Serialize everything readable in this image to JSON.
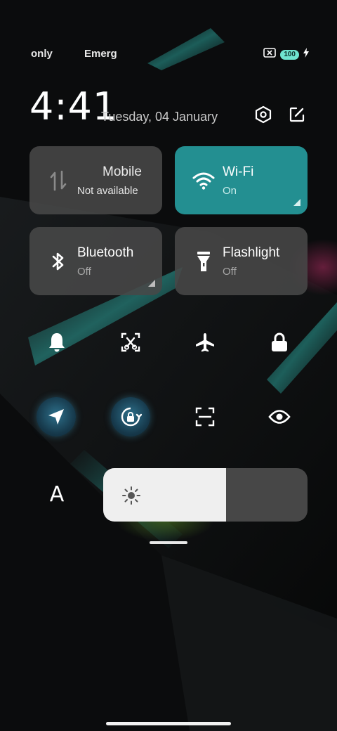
{
  "status_bar": {
    "carrier_1": "only",
    "carrier_2": "Emerg",
    "battery_level": "100",
    "icons": [
      "sim-error-icon",
      "battery-icon",
      "charging-icon"
    ]
  },
  "header": {
    "time": "4:41",
    "date": "Tuesday, 04 January",
    "settings_icon": "settings-hexagon-icon",
    "edit_icon": "edit-icon"
  },
  "tiles": [
    {
      "key": "mobile",
      "title": "Mobile",
      "subtitle": "Not available",
      "active": false,
      "icon": "mobile-data-icon"
    },
    {
      "key": "wifi",
      "title": "Wi-Fi",
      "subtitle": "On",
      "active": true,
      "icon": "wifi-icon"
    },
    {
      "key": "bluetooth",
      "title": "Bluetooth",
      "subtitle": "Off",
      "active": false,
      "icon": "bluetooth-icon"
    },
    {
      "key": "flashlight",
      "title": "Flashlight",
      "subtitle": "Off",
      "active": false,
      "icon": "flashlight-icon"
    }
  ],
  "toggles_row_1": [
    "bell-icon",
    "screenshot-icon",
    "airplane-icon",
    "lock-icon"
  ],
  "toggles_row_2": [
    {
      "icon": "location-icon",
      "active": true
    },
    {
      "icon": "rotation-lock-icon",
      "active": true
    },
    {
      "icon": "scanner-icon",
      "active": false
    },
    {
      "icon": "eye-icon",
      "active": false
    }
  ],
  "brightness": {
    "auto_label": "A",
    "level": 0.6,
    "icon": "sun-icon"
  },
  "colors": {
    "accent": "#238f91",
    "tile_inactive": "#484848",
    "active_round": "#16384a"
  }
}
